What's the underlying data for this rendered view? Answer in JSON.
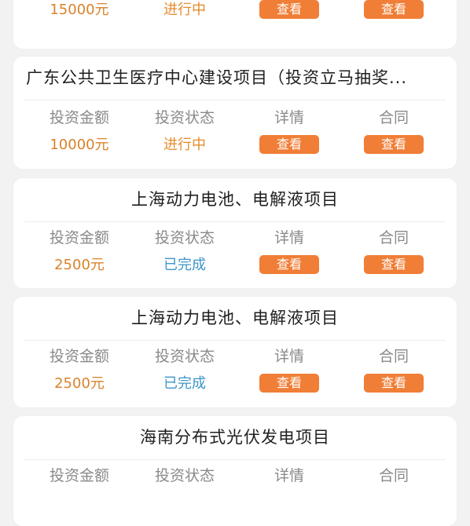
{
  "columns": {
    "amount_label": "投资金额",
    "status_label": "投资状态",
    "detail_label": "详情",
    "contract_label": "合同"
  },
  "button_label": "查看",
  "colors": {
    "accent": "#f07e36",
    "amount": "#d9822b",
    "in_progress": "#e58c2c",
    "completed": "#3f95c9"
  },
  "projects": [
    {
      "title": "",
      "amount": "15000元",
      "status": "进行中"
    },
    {
      "title": "广东公共卫生医疗中心建设项目（投资立马抽奖...",
      "amount": "10000元",
      "status": "进行中"
    },
    {
      "title": "上海动力电池、电解液项目",
      "amount": "2500元",
      "status": "已完成"
    },
    {
      "title": "上海动力电池、电解液项目",
      "amount": "2500元",
      "status": "已完成"
    },
    {
      "title": "海南分布式光伏发电项目",
      "amount": "",
      "status": ""
    }
  ]
}
